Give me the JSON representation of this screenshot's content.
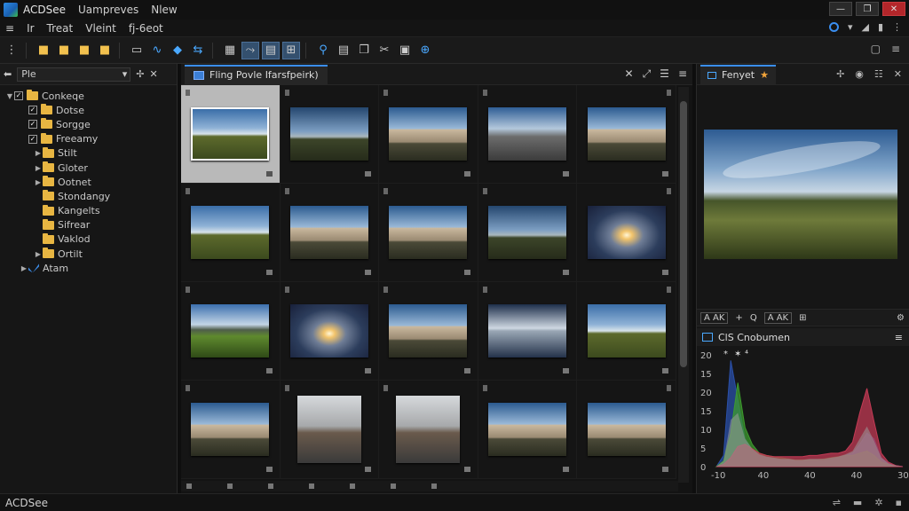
{
  "window": {
    "app_title": "ACDSee",
    "title_menus": [
      "Uampreves",
      "Nlew"
    ],
    "controls": [
      "—",
      "❐",
      "✕"
    ]
  },
  "menubar": {
    "items": [
      "≡",
      "Ⅰr",
      "Treat",
      "Vleint",
      "fj-6eot"
    ]
  },
  "left_panel": {
    "path_value": "Ple",
    "tree": [
      {
        "label": "Conkeqe",
        "depth": 0,
        "arrow": "▼",
        "icon": "folder",
        "check": true
      },
      {
        "label": "Dotse",
        "depth": 1,
        "arrow": "",
        "icon": "folder",
        "check": true
      },
      {
        "label": "Sorgge",
        "depth": 1,
        "arrow": "",
        "icon": "folder",
        "check": true
      },
      {
        "label": "Freeamy",
        "depth": 1,
        "arrow": "",
        "icon": "folder",
        "check": true
      },
      {
        "label": "Stilt",
        "depth": 2,
        "arrow": "▶",
        "icon": "folder",
        "check": false
      },
      {
        "label": "Gloter",
        "depth": 2,
        "arrow": "▶",
        "icon": "folder",
        "check": false
      },
      {
        "label": "Ootnet",
        "depth": 2,
        "arrow": "▶",
        "icon": "folder",
        "check": false
      },
      {
        "label": "Stondangy",
        "depth": 2,
        "arrow": "",
        "icon": "folder",
        "check": false
      },
      {
        "label": "Kangelts",
        "depth": 2,
        "arrow": "",
        "icon": "folder",
        "check": false
      },
      {
        "label": "Sifrear",
        "depth": 2,
        "arrow": "",
        "icon": "folder",
        "check": false
      },
      {
        "label": "Vaklod",
        "depth": 2,
        "arrow": "",
        "icon": "folder",
        "check": false
      },
      {
        "label": "Ortilt",
        "depth": 2,
        "arrow": "▶",
        "icon": "folder",
        "check": false
      },
      {
        "label": "Atam",
        "depth": 1,
        "arrow": "▶",
        "icon": "blue-check",
        "check": false
      }
    ]
  },
  "center": {
    "tab_label": "Fling Povle Ifarsfpeirk)",
    "thumbnails": [
      "sky-field",
      "sky-trees",
      "sky-build",
      "sky-road",
      "sky-build",
      "sky-field",
      "sky-build",
      "sky-build",
      "sky-trees",
      "sky-sun",
      "sky-mount",
      "sky-sun",
      "sky-build",
      "sky-mirror",
      "sky-field",
      "sky-build",
      "sky-gray",
      "sky-gray",
      "sky-build",
      "sky-build"
    ],
    "portrait_cells": [
      16,
      17
    ]
  },
  "right_panel": {
    "tab_label": "Fenyet",
    "toolbar_items": [
      "A AK",
      "+",
      "Q",
      "A AK",
      "⊞"
    ],
    "histogram_title": "ClS Cnobumen",
    "histogram_markers": [
      "*",
      "✶",
      "⁴"
    ],
    "histogram": {
      "type": "area",
      "y_ticks": [
        "20",
        "15",
        "20",
        "15",
        "10",
        "5",
        "0"
      ],
      "x_ticks": [
        "-10",
        "40",
        "40",
        "40",
        "30"
      ],
      "series": [
        {
          "color": "#2a4fa8",
          "values": [
            0,
            10,
            95,
            60,
            25,
            15,
            10,
            8,
            7,
            6,
            6,
            5,
            5,
            5,
            5,
            5,
            6,
            8,
            10,
            12,
            20,
            30,
            25,
            8,
            3,
            1,
            0
          ]
        },
        {
          "color": "#3c9a2e",
          "values": [
            0,
            5,
            30,
            75,
            35,
            20,
            12,
            10,
            9,
            8,
            7,
            6,
            6,
            6,
            6,
            7,
            8,
            9,
            10,
            10,
            12,
            14,
            10,
            4,
            2,
            0,
            0
          ]
        },
        {
          "color": "#c23a54",
          "values": [
            0,
            2,
            8,
            18,
            20,
            16,
            12,
            10,
            9,
            9,
            9,
            9,
            9,
            10,
            10,
            11,
            12,
            12,
            14,
            22,
            48,
            70,
            40,
            12,
            4,
            1,
            0
          ]
        }
      ]
    }
  },
  "statusbar": {
    "text": "ACDSee"
  }
}
